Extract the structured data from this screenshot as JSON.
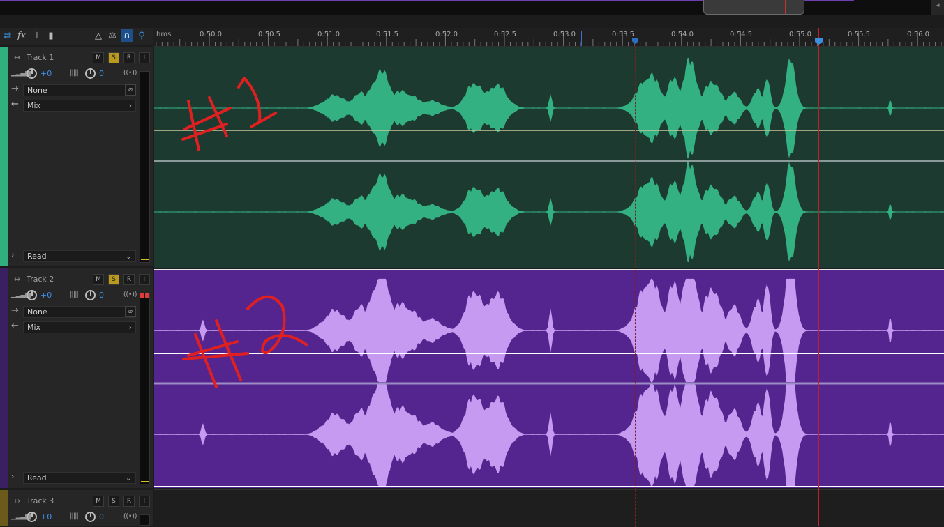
{
  "ruler": {
    "unit": "hms",
    "ticks": [
      "0:50.0",
      "0:50.5",
      "0:51.0",
      "0:51.5",
      "0:52.0",
      "0:52.5",
      "0:53.0",
      "0:53.5",
      "0:54.0",
      "0:54.5",
      "0:55.0",
      "0:55.5",
      "0:56.0"
    ]
  },
  "tracks": [
    {
      "name": "Track 1",
      "mute": "M",
      "solo": "S",
      "record": "R",
      "input": "I",
      "volume": "+0",
      "pan": "0",
      "input_select": "None",
      "output_select": "Mix",
      "automation": "Read",
      "color": "#2fb07e",
      "annotation": "#1"
    },
    {
      "name": "Track 2",
      "mute": "M",
      "solo": "S",
      "record": "R",
      "input": "I",
      "volume": "+0",
      "pan": "0",
      "input_select": "None",
      "output_select": "Mix",
      "automation": "Read",
      "color": "#3a2060",
      "annotation": "#2"
    },
    {
      "name": "Track 3",
      "mute": "M",
      "solo": "S",
      "record": "R",
      "input": "I",
      "volume": "+0",
      "pan": "0",
      "color": "#6b5a1a"
    }
  ],
  "colors": {
    "track1_clip_bg": "#1d3a30",
    "track1_wave": "#34b183",
    "track2_clip_bg": "#55258f",
    "track2_wave": "#c69af0",
    "playhead": "#c0202a",
    "accent": "#3a8fe0",
    "annotation": "#e02020"
  }
}
